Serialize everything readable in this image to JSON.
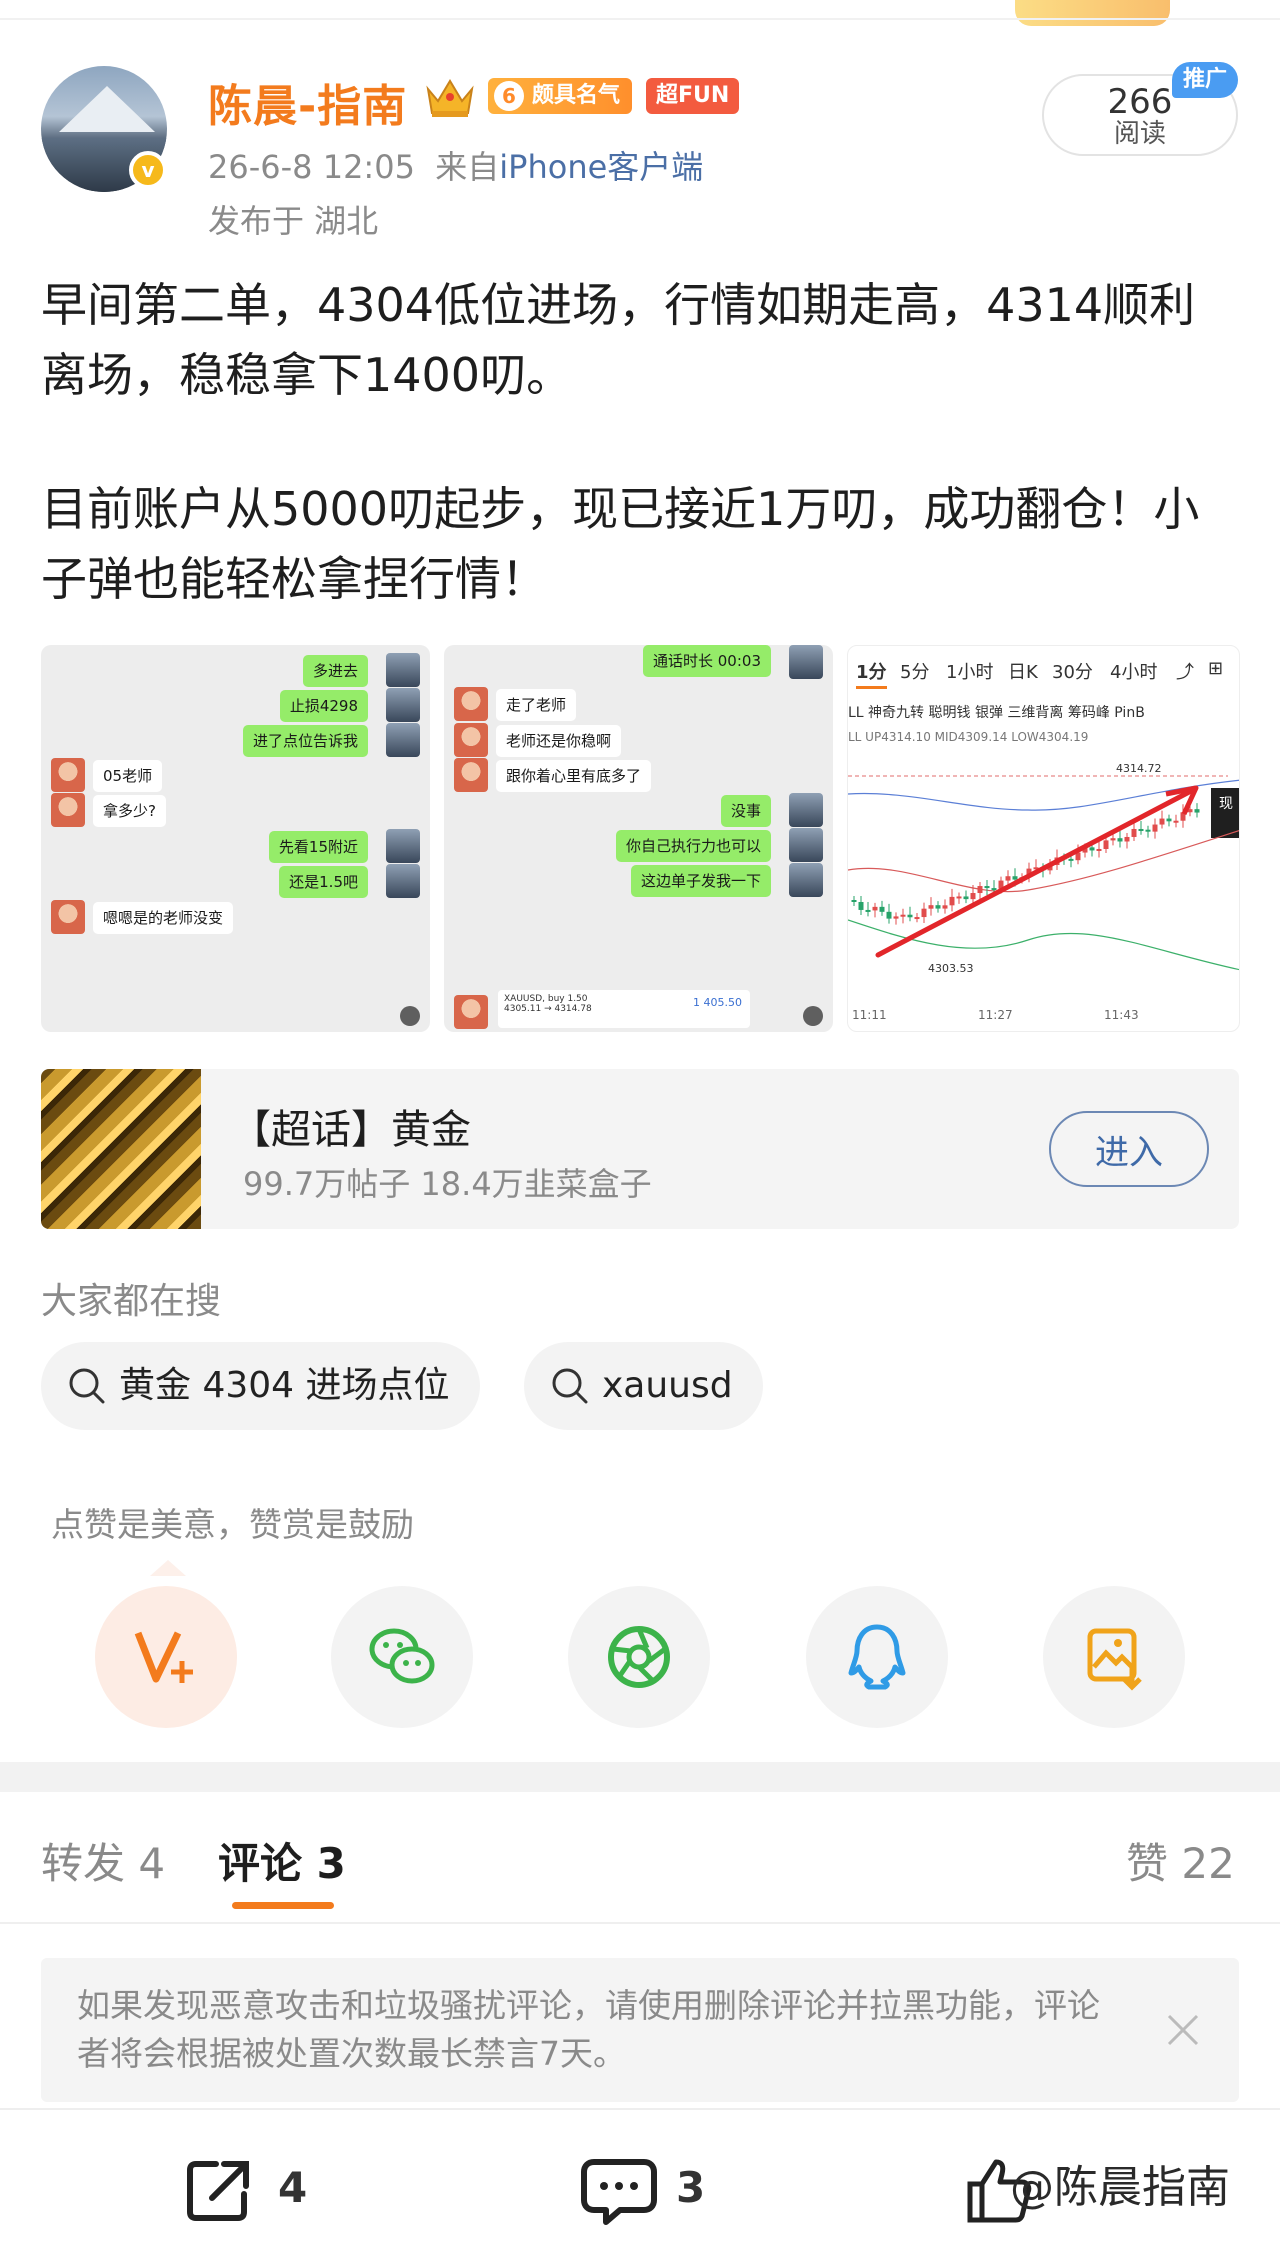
{
  "user": {
    "name": "陈晨-指南",
    "level": "6",
    "badge_label": "颇具名气",
    "fun_badge": "超FUN",
    "timestamp": "26-6-8 12:05",
    "source_prefix": "来自",
    "source": "iPhone客户端",
    "location": "发布于 湖北"
  },
  "read": {
    "count": "266",
    "label": "阅读",
    "promo": "推广"
  },
  "post": {
    "paragraph1": "早间第二单，4304低位进场，行情如期走高，4314顺利离场，稳稳拿下1400叨。",
    "paragraph2": "目前账户从5000叨起步，现已接近1万叨，成功翻仓！小子弹也能轻松拿捏行情！"
  },
  "image1": {
    "messages": [
      "多进去",
      "止损4298",
      "进了点位告诉我",
      "05老师",
      "拿多少?",
      "先看15附近",
      "还是1.5吧",
      "嗯嗯是的老师没变"
    ]
  },
  "image2": {
    "call": "通话时长 00:03",
    "messages": [
      "走了老师",
      "老师还是你稳啊",
      "跟你着心里有底多了",
      "没事",
      "你自己执行力也可以",
      "这边单子发我一下"
    ],
    "card_symbol": "XAUUSD, buy 1.50",
    "card_detail": "4305.11 → 4314.78",
    "card_profit": "1 405.50"
  },
  "image3": {
    "tabs": [
      "1分",
      "5分",
      "1小时",
      "日K",
      "30分",
      "4小时"
    ],
    "row2": "LL  神奇九转   聪明钱   银弹   三维背离   筹码峰   PinB",
    "row3": "LL UP4314.10 MID4309.14 LOW4304.19",
    "high_label": "4314.72",
    "low_label": "4303.53",
    "side_label": "现",
    "x_labels": [
      "11:11",
      "11:27",
      "11:43"
    ]
  },
  "supertopic": {
    "title": "【超话】黄金",
    "stats": "99.7万帖子 18.4万韭菜盒子",
    "enter_label": "进入"
  },
  "search": {
    "heading": "大家都在搜",
    "chips": [
      "黄金 4304 进场点位",
      "xauusd"
    ]
  },
  "praise": {
    "text": "点赞是美意，赞赏是鼓励"
  },
  "share_icons": [
    "vplus-icon",
    "wechat-icon",
    "moments-icon",
    "qq-icon",
    "save-image-icon"
  ],
  "tabs": {
    "repost": "转发 4",
    "comment": "评论 3",
    "like": "赞 22"
  },
  "notice": "如果发现恶意攻击和垃圾骚扰评论，请使用删除评论并拉黑功能，评论者将会根据被处置次数最长禁言7天。",
  "bottom_bar": {
    "repost_count": "4",
    "comment_count": "3"
  },
  "watermark": "@陈晨指南",
  "colors": {
    "brand_orange": "#f37b1d",
    "link_blue": "#4b6fa6",
    "chat_green": "#95ec69"
  }
}
